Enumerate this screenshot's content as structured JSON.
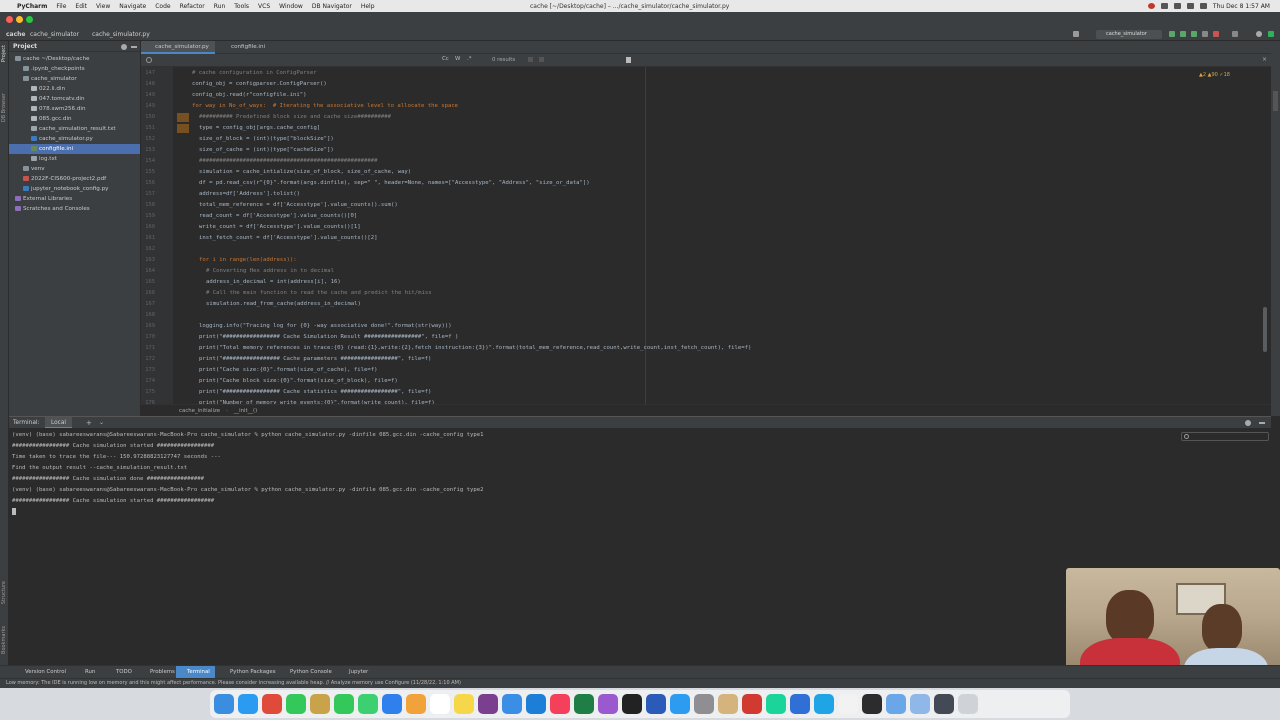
{
  "menubar": {
    "app_name": "PyCharm",
    "items": [
      "File",
      "Edit",
      "View",
      "Navigate",
      "Code",
      "Refactor",
      "Run",
      "Tools",
      "VCS",
      "Window",
      "DB Navigator",
      "Help"
    ],
    "window_title": "cache [~/Desktop/cache] – .../cache_simulator/cache_simulator.py",
    "clock": "Thu Dec 8  1:57 AM"
  },
  "navbar": {
    "crumb_project": "cache",
    "crumb_folder": "cache_simulator",
    "crumb_file": "cache_simulator.py",
    "run_config": "cache_simulator"
  },
  "project": {
    "header": "Project",
    "rows": [
      {
        "label": "cache  ~/Desktop/cache",
        "icon": "folder",
        "indent": 0,
        "selected": false
      },
      {
        "label": ".ipynb_checkpoints",
        "icon": "folder",
        "indent": 1,
        "selected": false
      },
      {
        "label": "cache_simulator",
        "icon": "folder",
        "indent": 1,
        "selected": false
      },
      {
        "label": "022.li.din",
        "icon": "din",
        "indent": 2,
        "selected": false
      },
      {
        "label": "047.tomcatv.din",
        "icon": "din",
        "indent": 2,
        "selected": false
      },
      {
        "label": "078.swm256.din",
        "icon": "din",
        "indent": 2,
        "selected": false
      },
      {
        "label": "085.gcc.din",
        "icon": "din",
        "indent": 2,
        "selected": false
      },
      {
        "label": "cache_simulation_result.txt",
        "icon": "txt",
        "indent": 2,
        "selected": false
      },
      {
        "label": "cache_simulator.py",
        "icon": "py",
        "indent": 2,
        "selected": false
      },
      {
        "label": "configfile.ini",
        "icon": "ini",
        "indent": 2,
        "selected": true
      },
      {
        "label": "log.txt",
        "icon": "txt",
        "indent": 2,
        "selected": false
      },
      {
        "label": "venv",
        "icon": "folder",
        "indent": 1,
        "selected": false
      },
      {
        "label": "2022F-CIS600-project2.pdf",
        "icon": "pdf",
        "indent": 1,
        "selected": false
      },
      {
        "label": "jupyter_notebook_config.py",
        "icon": "py",
        "indent": 1,
        "selected": false
      },
      {
        "label": "External Libraries",
        "icon": "lib",
        "indent": 0,
        "selected": false
      },
      {
        "label": "Scratches and Consoles",
        "icon": "lib",
        "indent": 0,
        "selected": false
      }
    ]
  },
  "editor": {
    "tabs": [
      {
        "label": "cache_simulator.py",
        "active": true
      },
      {
        "label": "configfile.ini",
        "active": false
      }
    ],
    "search_results": "0 results",
    "inspections": "▲2  ▲90  ✓18",
    "breadcrumb": [
      "cache_initialize",
      "__init__()"
    ],
    "lines": [
      {
        "n": "147",
        "indent": 5,
        "text": "# cache configuration in ConfigParser",
        "cls": "cmt"
      },
      {
        "n": "148",
        "indent": 5,
        "text": "config_obj = configparser.ConfigParser()",
        "cls": ""
      },
      {
        "n": "149",
        "indent": 5,
        "text": "config_obj.read(r\"configfile.ini\")",
        "cls": ""
      },
      {
        "n": "149",
        "indent": 5,
        "text": "for way in No_of_ways:  # Iterating the associative level to allocate the space",
        "cls": "kwline"
      },
      {
        "n": "150",
        "indent": 6,
        "text": "########## Predefined block size and cache size##########",
        "cls": "cmt"
      },
      {
        "n": "151",
        "indent": 6,
        "text": "type = config_obj[args.cache_config]",
        "cls": ""
      },
      {
        "n": "152",
        "indent": 6,
        "text": "size_of_block = (int)(type[\"blockSize\"])",
        "cls": ""
      },
      {
        "n": "153",
        "indent": 6,
        "text": "size_of_cache = (int)(type[\"cacheSize\"])",
        "cls": ""
      },
      {
        "n": "154",
        "indent": 6,
        "text": "#####################################################",
        "cls": "cmt"
      },
      {
        "n": "155",
        "indent": 6,
        "text": "simulation = cache_intialize(size_of_block, size_of_cache, way)",
        "cls": ""
      },
      {
        "n": "156",
        "indent": 6,
        "text": "df = pd.read_csv(r\"{0}\".format(args.dinfile), sep=\" \", header=None, names=[\"Accesstype\", \"Address\", \"size_or_data\"])",
        "cls": ""
      },
      {
        "n": "157",
        "indent": 6,
        "text": "address=df['Address'].tolist()",
        "cls": ""
      },
      {
        "n": "158",
        "indent": 6,
        "text": "total_mem_reference = df['Accesstype'].value_counts().sum()",
        "cls": ""
      },
      {
        "n": "159",
        "indent": 6,
        "text": "read_count = df['Accesstype'].value_counts()[0]",
        "cls": ""
      },
      {
        "n": "160",
        "indent": 6,
        "text": "write_count = df['Accesstype'].value_counts()[1]",
        "cls": ""
      },
      {
        "n": "161",
        "indent": 6,
        "text": "inst_fetch_count = df['Accesstype'].value_counts()[2]",
        "cls": ""
      },
      {
        "n": "162",
        "indent": 6,
        "text": "",
        "cls": ""
      },
      {
        "n": "163",
        "indent": 6,
        "text": "for i in range(len(address)):",
        "cls": "kwline"
      },
      {
        "n": "164",
        "indent": 7,
        "text": "# Converting Hex address in to decimal",
        "cls": "cmt"
      },
      {
        "n": "165",
        "indent": 7,
        "text": "address_in_decimal = int(address[i], 16)",
        "cls": ""
      },
      {
        "n": "166",
        "indent": 7,
        "text": "# Call the main function to read the cache and predict the hit/miss",
        "cls": "cmt"
      },
      {
        "n": "167",
        "indent": 7,
        "text": "simulation.read_from_cache(address_in_decimal)",
        "cls": ""
      },
      {
        "n": "168",
        "indent": 6,
        "text": "",
        "cls": ""
      },
      {
        "n": "169",
        "indent": 6,
        "text": "logging.info(\"Tracing log for {0} -way associative done!\".format(str(way)))",
        "cls": ""
      },
      {
        "n": "170",
        "indent": 6,
        "text": "print(\"################# Cache Simulation Result #################\", file=f )",
        "cls": "printline"
      },
      {
        "n": "171",
        "indent": 6,
        "text": "print(\"Total memory references in trace:{0} (read:{1},write:{2},fetch instruction:{3})\".format(total_mem_reference,read_count,write_count,inst_fetch_count), file=f)",
        "cls": "printline"
      },
      {
        "n": "172",
        "indent": 6,
        "text": "print(\"################# Cache parameters #################\", file=f)",
        "cls": "printline"
      },
      {
        "n": "173",
        "indent": 6,
        "text": "print(\"Cache size:{0}\".format(size_of_cache), file=f)",
        "cls": "printline"
      },
      {
        "n": "174",
        "indent": 6,
        "text": "print(\"Cache block size:{0}\".format(size_of_block), file=f)",
        "cls": "printline"
      },
      {
        "n": "175",
        "indent": 6,
        "text": "print(\"################# Cache statistics #################\", file=f)",
        "cls": "printline"
      },
      {
        "n": "176",
        "indent": 6,
        "text": "print(\"Number of memory write events:{0}\".format(write_count), file=f)",
        "cls": "printline"
      }
    ]
  },
  "terminal": {
    "title": "Terminal:",
    "tab_label": "Local",
    "lines": [
      "(venv) (base) sabareeswarans@Sabareeswarans-MacBook-Pro cache_simulator % python cache_simulator.py -dinfile 085.gcc.din -cache_config type1",
      "################# Cache simulation started #################",
      "Time taken to trace the file--- 150.97288823127747 seconds ---",
      "Find the output result --cache_simulation_result.txt",
      "################# Cache simulation done #################",
      "(venv) (base) sabareeswarans@Sabareeswarans-MacBook-Pro cache_simulator % python cache_simulator.py -dinfile 085.gcc.din -cache_config type2",
      "################# Cache simulation started #################"
    ]
  },
  "bottom_tools": [
    {
      "label": "Version Control",
      "active": false
    },
    {
      "label": "Run",
      "active": false
    },
    {
      "label": "TODO",
      "active": false
    },
    {
      "label": "Problems",
      "active": false
    },
    {
      "label": "Terminal",
      "active": true
    },
    {
      "label": "Python Packages",
      "active": false
    },
    {
      "label": "Python Console",
      "active": false
    },
    {
      "label": "Jupyter",
      "active": false
    }
  ],
  "statusbar": {
    "message": "Low memory: The IDE is running low on memory and this might affect performance. Please consider increasing available heap. // Analyze memory use   Configure (11/28/22, 1:10 AM)"
  },
  "left_strip_labels": [
    "Project",
    "DB Browser",
    "Structure",
    "Bookmarks"
  ],
  "dock_icons": [
    {
      "name": "finder-icon",
      "color": "#3b8de0"
    },
    {
      "name": "safari-icon",
      "color": "#2a9bf0"
    },
    {
      "name": "chrome-icon",
      "color": "#e04a3a"
    },
    {
      "name": "whatsapp-icon",
      "color": "#34c759"
    },
    {
      "name": "folder-icon",
      "color": "#c9a34a"
    },
    {
      "name": "facetime-icon",
      "color": "#34c759"
    },
    {
      "name": "messages-icon",
      "color": "#3cd070"
    },
    {
      "name": "vscode-icon",
      "color": "#2f80ed"
    },
    {
      "name": "photos-icon",
      "color": "#f2a23a"
    },
    {
      "name": "calendar-icon",
      "color": "#ffffff"
    },
    {
      "name": "notes-icon",
      "color": "#f7d74a"
    },
    {
      "name": "slack-icon",
      "color": "#7b3f8f"
    },
    {
      "name": "mail-icon",
      "color": "#3a8ee6"
    },
    {
      "name": "xcode-icon",
      "color": "#1c7ed6"
    },
    {
      "name": "music-icon",
      "color": "#f5405c"
    },
    {
      "name": "excel-icon",
      "color": "#1e7e45"
    },
    {
      "name": "podcasts-icon",
      "color": "#9b59d0"
    },
    {
      "name": "appletv-icon",
      "color": "#222222"
    },
    {
      "name": "word-icon",
      "color": "#2b5bb8"
    },
    {
      "name": "appstore-icon",
      "color": "#2d9cf0"
    },
    {
      "name": "settings-icon",
      "color": "#8e8e93"
    },
    {
      "name": "preview-icon",
      "color": "#d4b37c"
    },
    {
      "name": "acrobat-icon",
      "color": "#d13a30"
    },
    {
      "name": "pycharm-icon",
      "color": "#1bd49a"
    },
    {
      "name": "keynote-icon",
      "color": "#2f6fd6"
    },
    {
      "name": "skype-icon",
      "color": "#1fa4e6"
    },
    {
      "name": "textedit-icon",
      "color": "#f2f2f2"
    },
    {
      "name": "activity-icon",
      "color": "#2c2c2e"
    },
    {
      "name": "downloads-icon",
      "color": "#6aa7e8"
    },
    {
      "name": "documents-icon",
      "color": "#8fb8e8"
    },
    {
      "name": "screenshot-icon",
      "color": "#444a55"
    },
    {
      "name": "trash-icon",
      "color": "#cfd3d8"
    }
  ]
}
